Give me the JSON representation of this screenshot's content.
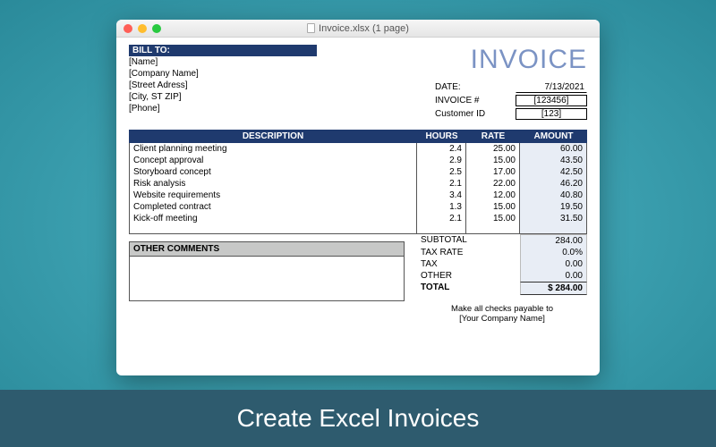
{
  "banner": "Create Excel Invoices",
  "window": {
    "title": "Invoice.xlsx (1 page)"
  },
  "invoice_title": "INVOICE",
  "billto": {
    "header": "BILL TO:",
    "lines": [
      "[Name]",
      "[Company Name]",
      "[Street Adress]",
      "[City, ST  ZIP]",
      "[Phone]"
    ]
  },
  "meta": {
    "date_label": "DATE:",
    "date_value": "7/13/2021",
    "invoice_no_label": "INVOICE #",
    "invoice_no_value": "[123456]",
    "customer_id_label": "Customer ID",
    "customer_id_value": "[123]"
  },
  "columns": {
    "description": "DESCRIPTION",
    "hours": "HOURS",
    "rate": "RATE",
    "amount": "AMOUNT"
  },
  "rows": [
    {
      "desc": "Client planning meeting",
      "hours": "2.4",
      "rate": "25.00",
      "amount": "60.00"
    },
    {
      "desc": "Concept approval",
      "hours": "2.9",
      "rate": "15.00",
      "amount": "43.50"
    },
    {
      "desc": "Storyboard concept",
      "hours": "2.5",
      "rate": "17.00",
      "amount": "42.50"
    },
    {
      "desc": "Risk analysis",
      "hours": "2.1",
      "rate": "22.00",
      "amount": "46.20"
    },
    {
      "desc": "Website requirements",
      "hours": "3.4",
      "rate": "12.00",
      "amount": "40.80"
    },
    {
      "desc": "Completed contract",
      "hours": "1.3",
      "rate": "15.00",
      "amount": "19.50"
    },
    {
      "desc": "Kick-off meeting",
      "hours": "2.1",
      "rate": "15.00",
      "amount": "31.50"
    }
  ],
  "empty_rows": 5,
  "comments_header": "OTHER COMMENTS",
  "totals": {
    "subtotal_label": "SUBTOTAL",
    "subtotal": "284.00",
    "taxrate_label": "TAX RATE",
    "taxrate": "0.0%",
    "tax_label": "TAX",
    "tax": "0.00",
    "other_label": "OTHER",
    "other": "0.00",
    "total_label": "TOTAL",
    "total": "$ 284.00"
  },
  "payable": {
    "line1": "Make all checks payable to",
    "line2": "[Your Company Name]"
  }
}
